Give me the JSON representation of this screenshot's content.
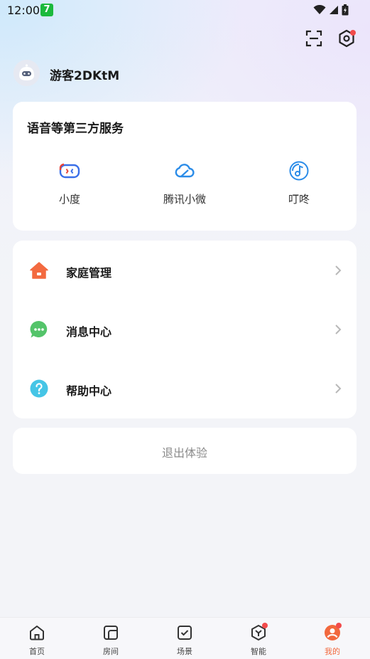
{
  "status_bar": {
    "time": "12:00",
    "app_badge": "7"
  },
  "profile": {
    "username": "游客2DKtM"
  },
  "services": {
    "title": "语音等第三方服务",
    "items": [
      {
        "label": "小度",
        "icon": "xiaodu-icon"
      },
      {
        "label": "腾讯小微",
        "icon": "cloud-icon"
      },
      {
        "label": "叮咚",
        "icon": "music-note-icon"
      }
    ]
  },
  "menu": {
    "items": [
      {
        "label": "家庭管理",
        "icon": "home-icon"
      },
      {
        "label": "消息中心",
        "icon": "message-icon"
      },
      {
        "label": "帮助中心",
        "icon": "help-icon"
      }
    ]
  },
  "logout": {
    "label": "退出体验"
  },
  "bottom_nav": {
    "items": [
      {
        "label": "首页",
        "icon": "home-outline-icon"
      },
      {
        "label": "房间",
        "icon": "room-icon"
      },
      {
        "label": "场景",
        "icon": "scene-icon"
      },
      {
        "label": "智能",
        "icon": "smart-icon"
      },
      {
        "label": "我的",
        "icon": "profile-icon"
      }
    ],
    "active_index": 4
  },
  "colors": {
    "accent": "#f2683d",
    "home_icon": "#f36a40",
    "message_icon": "#54c46a",
    "help_icon": "#45c5e6",
    "service_blue": "#2b8ce8",
    "badge_red": "#f24b4b"
  }
}
